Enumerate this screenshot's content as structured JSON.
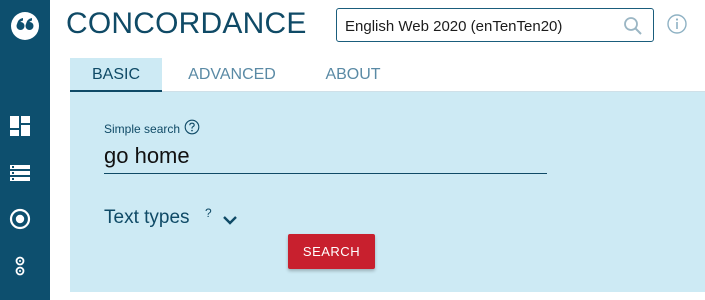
{
  "app": {
    "title": "CONCORDANCE"
  },
  "corpus": {
    "selected": "English Web 2020 (enTenTen20)"
  },
  "tabs": [
    {
      "label": "BASIC",
      "active": true
    },
    {
      "label": "ADVANCED",
      "active": false
    },
    {
      "label": "ABOUT",
      "active": false
    }
  ],
  "form": {
    "simple_search_label": "Simple search",
    "query_value": "go home",
    "text_types_label": "Text types",
    "text_types_help": "?",
    "search_button": "SEARCH"
  },
  "sidebar": {
    "icons": [
      "sketch-engine-logo-icon",
      "dashboard-icon",
      "list-icon",
      "record-icon",
      "settings-icon"
    ]
  },
  "colors": {
    "sidebar": "#0d4f6e",
    "title": "#0f4a66",
    "panel": "#cdeaf4",
    "search_button": "#c8202e"
  }
}
